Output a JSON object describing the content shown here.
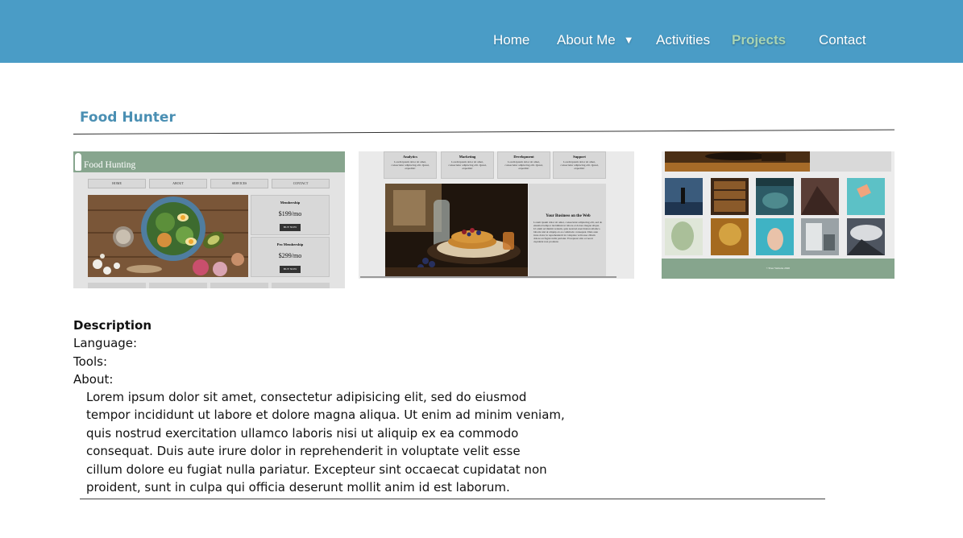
{
  "nav": {
    "items": [
      {
        "label": "Home"
      },
      {
        "label": "About Me",
        "caret": "▼"
      },
      {
        "label": "Activities"
      },
      {
        "label": "Projects",
        "active": true
      },
      {
        "label": "Contact"
      }
    ],
    "bg_color": "#4a9cc6",
    "active_color": "#a8d4b4"
  },
  "project": {
    "title": "Food Hunter",
    "title_color": "#4a8fb3"
  },
  "thumb1": {
    "brand": "Food Hunting",
    "nav": [
      "HOME",
      "ABOUT",
      "SERVICES",
      "CONTACT"
    ],
    "cards": [
      {
        "title": "Membership",
        "price": "$199/mo",
        "button": "BUY NOW"
      },
      {
        "title": "Pro Membership",
        "price": "$299/mo",
        "button": "BUY NOW"
      }
    ]
  },
  "thumb2": {
    "columns": [
      {
        "title": "Analytics",
        "text": "Lorem ipsum dolor sit amet, consectetur adipiscing elit. Quasi, expedita!"
      },
      {
        "title": "Marketing",
        "text": "Lorem ipsum dolor sit amet, consectetur adipiscing elit. Quasi, expedita!"
      },
      {
        "title": "Development",
        "text": "Lorem ipsum dolor sit amet, consectetur adipiscing elit. Quasi, expedita!"
      },
      {
        "title": "Support",
        "text": "Lorem ipsum dolor sit amet, consectetur adipiscing elit. Quasi, expedita!"
      }
    ],
    "panel_title": "Your Business on the Web",
    "panel_text": "Lorem ipsum dolor sit amet, consectetur adipiscing elit, sed do eiusmod tempor incididunt ut labore et dolore magna aliqua. Ut enim ad minim veniam, quis nostrud exercitation ullamco laboris nisi ut aliquip ex ea commodo consequat. Duis aute irure dolor in reprehenderit in voluptate velit esse cillum dolore eu fugiat nulla pariatur. Excepteur sint occaecat cupidatat non proident."
  },
  "thumb3": {
    "footer": "©Your Website 2020"
  },
  "description": {
    "heading": "Description",
    "language": "Language:",
    "tools": "Tools:",
    "about_label": "About:",
    "about_text": "Lorem ipsum dolor sit amet, consectetur adipisicing elit, sed do eiusmod\ntempor incididunt ut labore et dolore magna aliqua. Ut enim ad minim veniam,\nquis nostrud exercitation ullamco laboris nisi ut aliquip ex ea commodo\nconsequat. Duis aute irure dolor in reprehenderit in voluptate velit esse\ncillum dolore eu fugiat nulla pariatur. Excepteur sint occaecat cupidatat non\nproident, sunt in culpa qui officia deserunt mollit anim id est laborum."
  }
}
